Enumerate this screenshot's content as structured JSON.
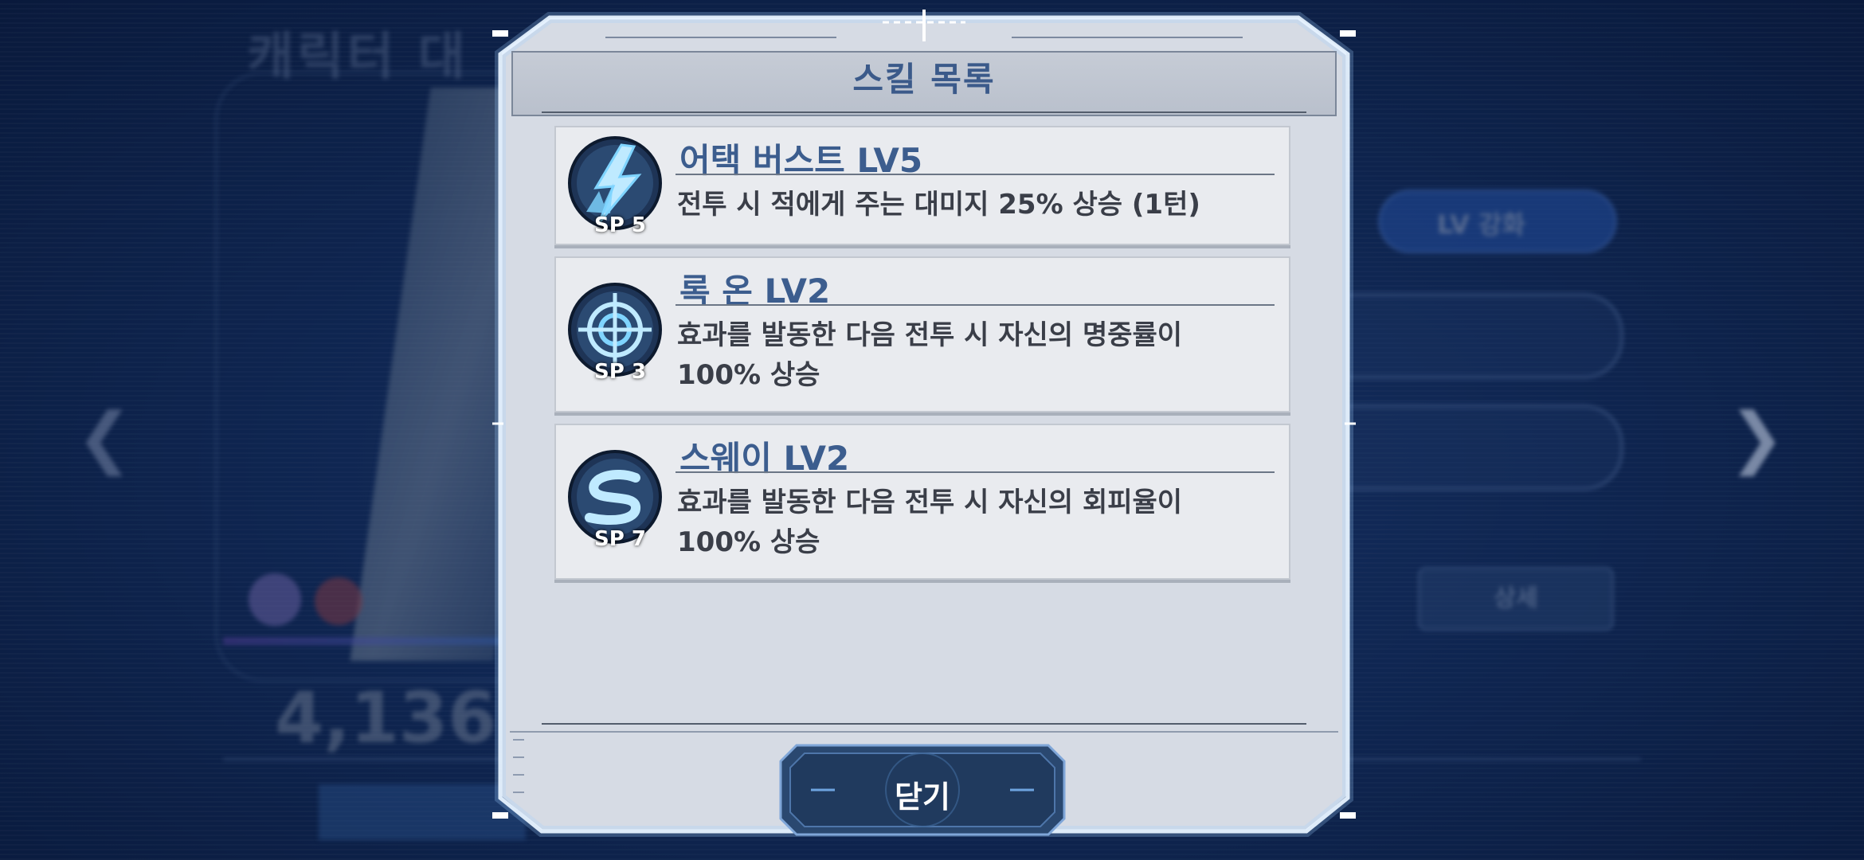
{
  "background": {
    "title": "캐릭터 대",
    "level_button": "LV 강화",
    "detail_button": "상세",
    "power_value": "4,136"
  },
  "dialog": {
    "title": "스킬 목록",
    "skills": [
      {
        "name": "어택 버스트 LV5",
        "desc": "전투 시 적에게 주는 대미지 25% 상승 (1턴)",
        "sp": "SP 5",
        "icon": "lightning-bolt-icon"
      },
      {
        "name": "록 온 LV2",
        "desc": "효과를 발동한 다음 전투 시 자신의 명중률이\n100% 상승",
        "sp": "SP 3",
        "icon": "crosshair-icon"
      },
      {
        "name": "스웨이 LV2",
        "desc": "효과를 발동한 다음 전투 시 자신의 회피율이\n100% 상승",
        "sp": "SP 7",
        "icon": "sway-s-icon"
      }
    ],
    "close_label": "닫기"
  },
  "colors": {
    "accent": "#3c5d8e",
    "panel": "#d6dbe4",
    "card": "#e9ebef",
    "icon_glow": "#7fd4ff"
  }
}
